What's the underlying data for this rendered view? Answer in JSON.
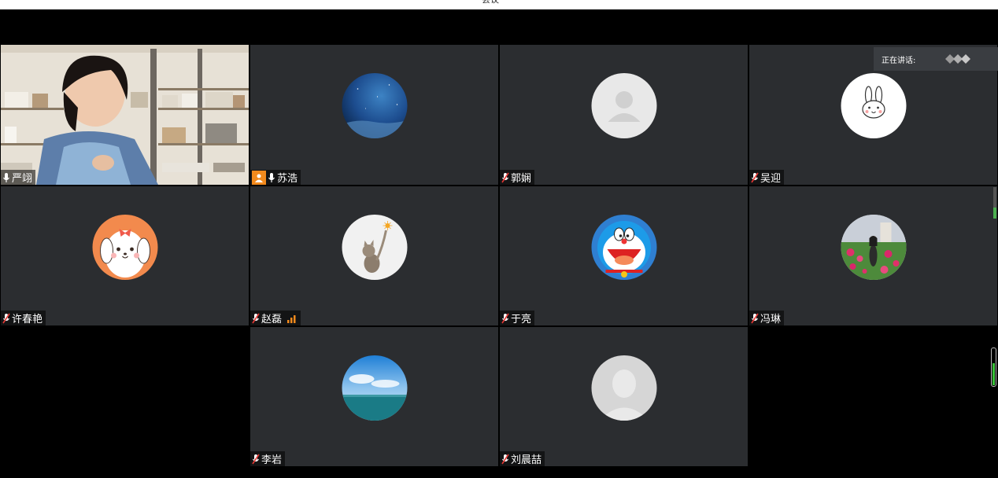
{
  "window": {
    "title": "会议"
  },
  "speaking": {
    "label": "正在讲话:"
  },
  "participants": [
    {
      "name": "严翊",
      "mic": "on",
      "video": true,
      "avatar": "camera-feed"
    },
    {
      "name": "苏浩",
      "mic": "on",
      "host": true,
      "avatar": "starry-night-sky"
    },
    {
      "name": "郭娴",
      "mic": "muted",
      "avatar": "default-person"
    },
    {
      "name": "吴迎",
      "mic": "muted",
      "avatar": "cartoon-rabbit"
    },
    {
      "name": "许春艳",
      "mic": "muted",
      "avatar": "cartoon-puppy"
    },
    {
      "name": "赵磊",
      "mic": "muted",
      "signal": "strong",
      "avatar": "kitten"
    },
    {
      "name": "于亮",
      "mic": "muted",
      "avatar": "doraemon"
    },
    {
      "name": "冯琳",
      "mic": "muted",
      "avatar": "woman-in-flowers"
    },
    {
      "name": "李岩",
      "mic": "muted",
      "avatar": "sea-and-sky"
    },
    {
      "name": "刘晨喆",
      "mic": "muted",
      "avatar": "default-person-silhouette"
    }
  ],
  "levels": {
    "scroll_position": 0.35,
    "mic_level": 0.6
  },
  "colors": {
    "tile_bg": "#2b2d30",
    "host_badge": "#f28a1d",
    "mute_red": "#e53935",
    "level_green": "#39c339"
  }
}
